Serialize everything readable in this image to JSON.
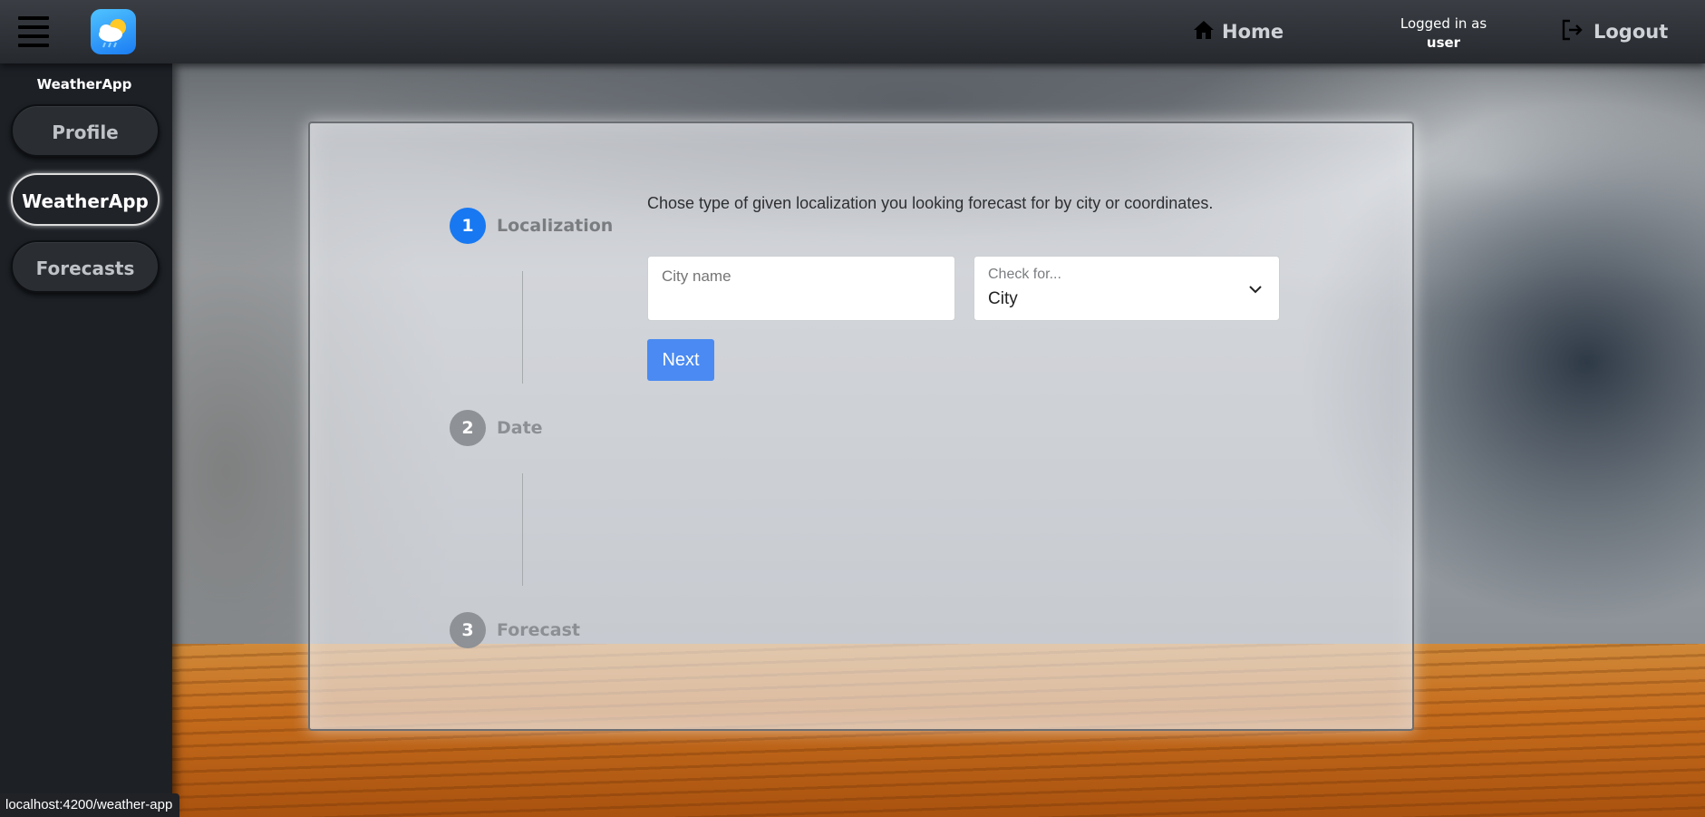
{
  "header": {
    "menu_icon": "hamburger-icon",
    "logo_icon": "weather-cloud-sun-icon",
    "home_label": "Home",
    "home_icon": "home-icon",
    "logged_in_label": "Logged in as",
    "username": "user",
    "logout_label": "Logout",
    "logout_icon": "logout-icon"
  },
  "sidebar": {
    "title": "WeatherApp",
    "items": [
      {
        "label": "Profile",
        "active": false
      },
      {
        "label": "WeatherApp",
        "active": true
      },
      {
        "label": "Forecasts",
        "active": false
      }
    ]
  },
  "stepper": {
    "steps": [
      {
        "number": "1",
        "label": "Localization",
        "state": "active"
      },
      {
        "number": "2",
        "label": "Date",
        "state": "inactive"
      },
      {
        "number": "3",
        "label": "Forecast",
        "state": "inactive"
      }
    ]
  },
  "form": {
    "instruction": "Chose type of given localization you looking forecast for by city or coordinates.",
    "city_input": {
      "placeholder": "City name",
      "value": ""
    },
    "check_select": {
      "label": "Check for...",
      "value": "City",
      "icon": "chevron-down-icon"
    },
    "next_label": "Next"
  },
  "status_bar": {
    "url": "localhost:4200/weather-app"
  },
  "colors": {
    "accent": "#1778f2",
    "button": "#4a8af2",
    "sidebar_bg": "#1d2126",
    "topbar_bg": "#2f3237"
  }
}
